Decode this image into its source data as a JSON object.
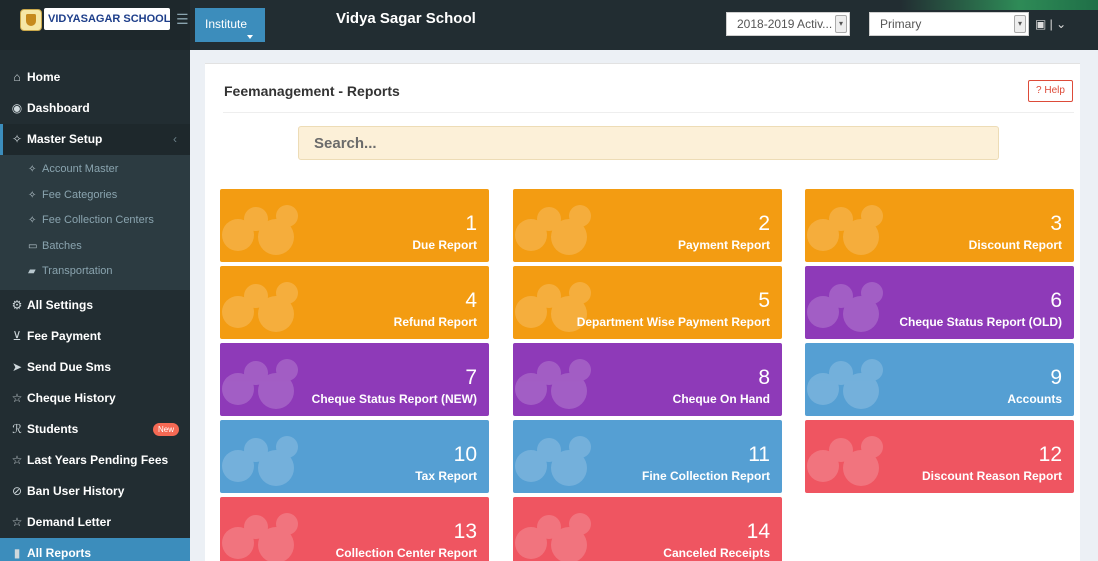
{
  "topbar": {
    "brand": "VIDYASAGAR SCHOOL",
    "institute_tab": "Institute",
    "school_title": "Vidya Sagar School",
    "session_select": "2018-2019 Activ...",
    "section_select": "Primary",
    "hamburger_icon": "hamburger-icon",
    "user_icon": "user-icon"
  },
  "sidebar": {
    "items": [
      {
        "label": "Home",
        "icon": "home-icon"
      },
      {
        "label": "Dashboard",
        "icon": "dashboard-icon"
      },
      {
        "label": "Master Setup",
        "icon": "handshake-icon"
      },
      {
        "label": "All Settings",
        "icon": "gear-icon"
      },
      {
        "label": "Fee Payment",
        "icon": "cart-icon"
      },
      {
        "label": "Send Due Sms",
        "icon": "paper-plane-icon"
      },
      {
        "label": "Cheque History",
        "icon": "star-icon"
      },
      {
        "label": "Students",
        "icon": "students-icon",
        "badge": "New"
      },
      {
        "label": "Last Years Pending Fees",
        "icon": "star-icon"
      },
      {
        "label": "Ban User History",
        "icon": "ban-icon"
      },
      {
        "label": "Demand Letter",
        "icon": "star-icon"
      },
      {
        "label": "All Reports",
        "icon": "reports-icon"
      }
    ],
    "sub_items": [
      {
        "label": "Account Master",
        "icon": "handshake-icon"
      },
      {
        "label": "Fee Categories",
        "icon": "handshake-icon"
      },
      {
        "label": "Fee Collection Centers",
        "icon": "handshake-icon"
      },
      {
        "label": "Batches",
        "icon": "calendar-icon"
      },
      {
        "label": "Transportation",
        "icon": "truck-icon"
      }
    ]
  },
  "main": {
    "title": "Feemanagement - Reports",
    "help_label": "Help",
    "search_placeholder": "Search...",
    "tiles": [
      {
        "num": "1",
        "label": "Due Report",
        "color": "#f39c12"
      },
      {
        "num": "2",
        "label": "Payment Report",
        "color": "#f39c12"
      },
      {
        "num": "3",
        "label": "Discount Report",
        "color": "#f39c12"
      },
      {
        "num": "4",
        "label": "Refund Report",
        "color": "#f39c12"
      },
      {
        "num": "5",
        "label": "Department Wise Payment Report",
        "color": "#f39c12"
      },
      {
        "num": "6",
        "label": "Cheque Status Report (OLD)",
        "color": "#8e3ab8"
      },
      {
        "num": "7",
        "label": "Cheque Status Report (NEW)",
        "color": "#8e3ab8"
      },
      {
        "num": "8",
        "label": "Cheque On Hand",
        "color": "#8e3ab8"
      },
      {
        "num": "9",
        "label": "Accounts",
        "color": "#559fd3"
      },
      {
        "num": "10",
        "label": "Tax Report",
        "color": "#559fd3"
      },
      {
        "num": "11",
        "label": "Fine Collection Report",
        "color": "#559fd3"
      },
      {
        "num": "12",
        "label": "Discount Reason Report",
        "color": "#ef5561"
      },
      {
        "num": "13",
        "label": "Collection Center Report",
        "color": "#ef5561"
      },
      {
        "num": "14",
        "label": "Canceled Receipts",
        "color": "#ef5561"
      }
    ]
  }
}
